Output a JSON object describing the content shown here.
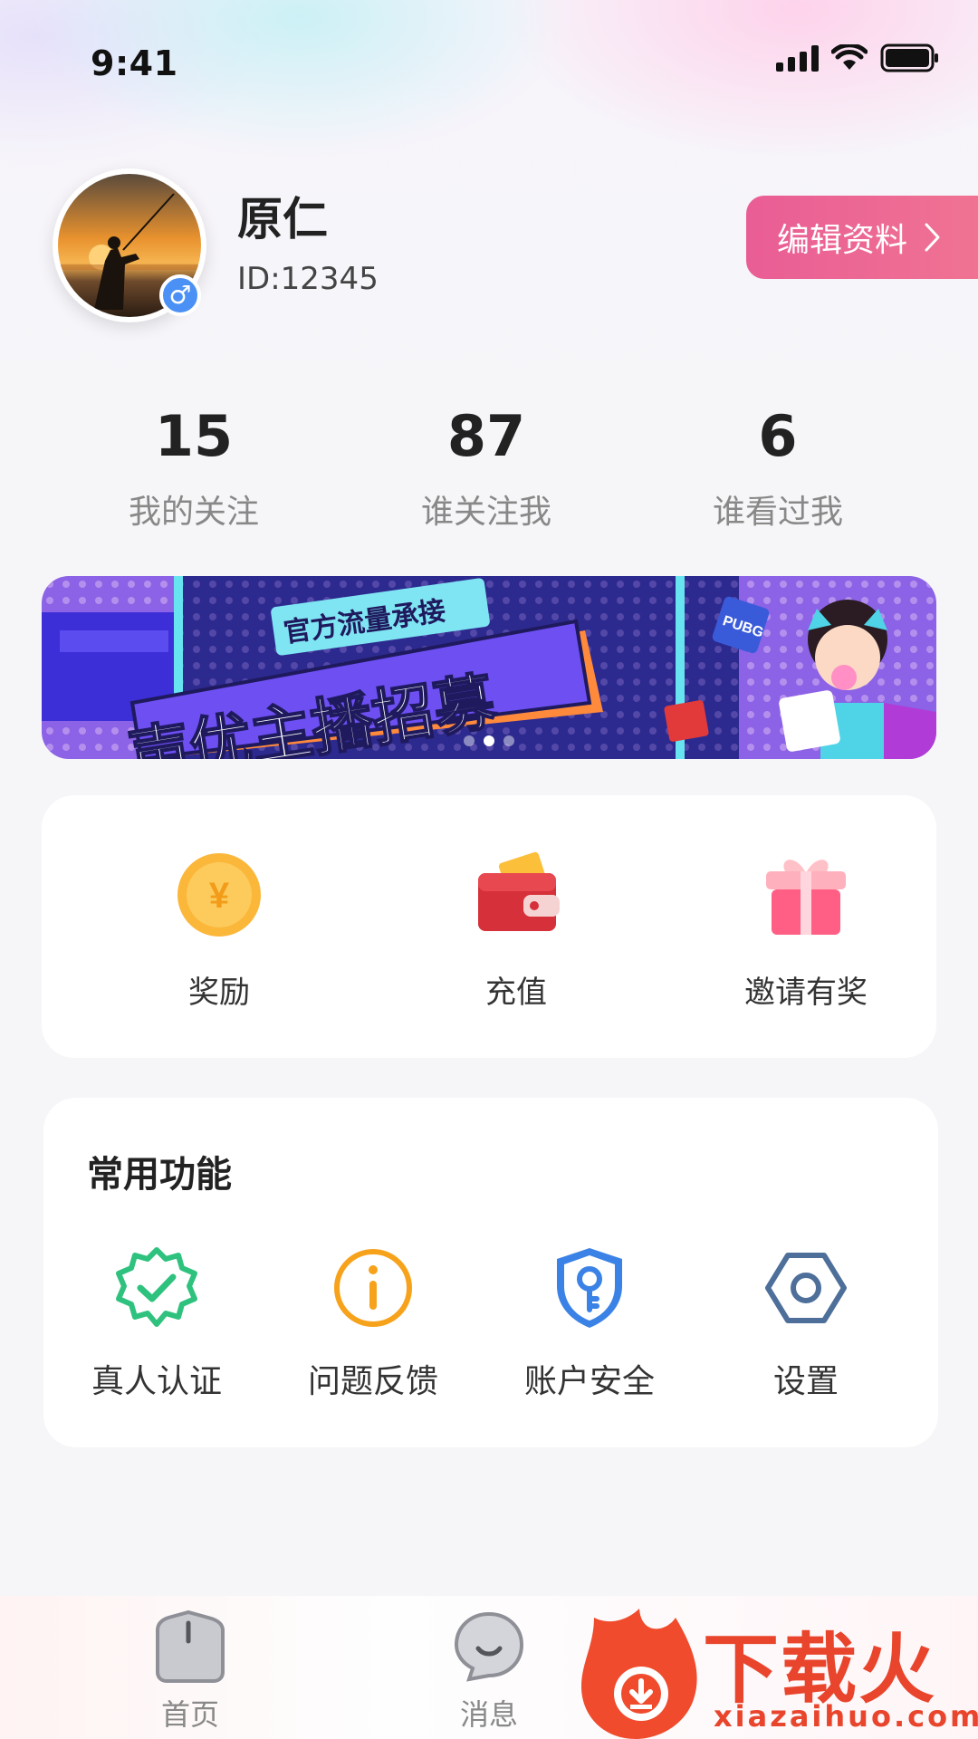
{
  "status_bar": {
    "time": "9:41"
  },
  "profile": {
    "name": "原仁",
    "id_text": "ID:12345",
    "gender_symbol": "♂",
    "edit_label": "编辑资料"
  },
  "stats": [
    {
      "value": "15",
      "label": "我的关注"
    },
    {
      "value": "87",
      "label": "谁关注我"
    },
    {
      "value": "6",
      "label": "谁看过我"
    }
  ],
  "banner": {
    "tag": "官方流量承接",
    "headline": "声优主播招募",
    "badge": "PUBG",
    "slide_count": 3,
    "active_slide": 2
  },
  "wallet": [
    {
      "label": "奖励",
      "icon": "coin-icon",
      "glyph": "¥"
    },
    {
      "label": "充值",
      "icon": "wallet-icon"
    },
    {
      "label": "邀请有奖",
      "icon": "gift-icon"
    }
  ],
  "common_functions": {
    "title": "常用功能",
    "items": [
      {
        "label": "真人认证",
        "icon": "verified-badge-icon"
      },
      {
        "label": "问题反馈",
        "icon": "info-circle-icon"
      },
      {
        "label": "账户安全",
        "icon": "shield-key-icon"
      },
      {
        "label": "设置",
        "icon": "hexagon-gear-icon"
      }
    ]
  },
  "tabbar": [
    {
      "label": "首页",
      "icon": "home-icon"
    },
    {
      "label": "消息",
      "icon": "message-icon"
    }
  ],
  "watermark": {
    "text": "下载火",
    "sub": "xiazaihuo.com"
  },
  "colors": {
    "accent_pink": "#e95d95",
    "verify_green": "#2ec27e",
    "feedback_orange": "#f7a21b",
    "security_blue": "#3b82e6",
    "settings_slate": "#4d6f99"
  }
}
